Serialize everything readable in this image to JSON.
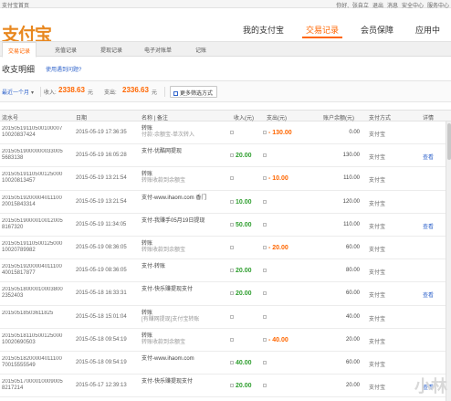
{
  "topbar": {
    "site": "支付宝首页",
    "links": [
      "你好,",
      "张自立",
      "退出",
      "消息",
      "安全中心",
      "服务中心"
    ]
  },
  "logo": "支付宝",
  "mainnav": [
    "我的支付宝",
    "交易记录",
    "会员保障",
    "应用中"
  ],
  "mainnav_active": 1,
  "subnav": [
    "交易记录",
    "充值记录",
    "提现记录",
    "电子对账单",
    "记账"
  ],
  "title": {
    "text": "收支明细",
    "link": "使用遇到问题?"
  },
  "filter": {
    "range": "最近一个月",
    "income_label": "收入:",
    "income_amount": "2338.63",
    "income_unit": "元",
    "expense_label": "支出:",
    "expense_amount": "2336.63",
    "expense_unit": "元",
    "more_btn": "更多筛选方式"
  },
  "table": {
    "headers": [
      "流水号",
      "日期",
      "名称 | 备注",
      "收入(元)",
      "支出(元)",
      "账户余额(元)",
      "支付方式",
      "详情"
    ],
    "rows": [
      {
        "sn1": "20150519110500100007",
        "sn2": "10020837424",
        "date": "2015-05-19 17:36:35",
        "name": "转账",
        "note": "付款-余额宝-单次转入",
        "income": "",
        "expense": "- 130.00",
        "balance": "0.00",
        "channel": "支付宝",
        "op": ""
      },
      {
        "sn1": "20150519000000033005",
        "sn2": "5683138",
        "date": "2015-05-19 16:05:28",
        "name": "支付-优酷网提现",
        "note": "",
        "income": "20.00",
        "expense": "",
        "balance": "130.00",
        "channel": "支付宝",
        "op": "查看"
      },
      {
        "sn1": "20150519110500125000",
        "sn2": "10020813457",
        "date": "2015-05-19 13:21:54",
        "name": "转账",
        "note": "转账收款到余额宝",
        "income": "",
        "expense": "- 10.00",
        "balance": "110.00",
        "channel": "支付宝",
        "op": ""
      },
      {
        "sn1": "20150519200004011100",
        "sn2": "20015843314",
        "date": "2015-05-19 13:21:54",
        "name": "支付-www.ihaom.com 香门",
        "note": "",
        "income": "10.00",
        "expense": "",
        "balance": "120.00",
        "channel": "支付宝",
        "op": ""
      },
      {
        "sn1": "20150519000010012005",
        "sn2": "8167320",
        "date": "2015-05-19 11:34:05",
        "name": "支付-我赚手05月19日提现",
        "note": "",
        "income": "50.00",
        "expense": "",
        "balance": "110.00",
        "channel": "支付宝",
        "op": "查看"
      },
      {
        "sn1": "20150519110500125000",
        "sn2": "10020789982",
        "date": "2015-05-19 08:36:05",
        "name": "转账",
        "note": "转账收款到余额宝",
        "income": "",
        "expense": "- 20.00",
        "balance": "60.00",
        "channel": "支付宝",
        "op": ""
      },
      {
        "sn1": "20150519200004011100",
        "sn2": "40015817877",
        "date": "2015-05-19 08:36:05",
        "name": "支付-转账",
        "note": "",
        "income": "20.00",
        "expense": "",
        "balance": "80.00",
        "channel": "支付宝",
        "op": ""
      },
      {
        "sn1": "20150518000010003800",
        "sn2": "2352403",
        "date": "2015-05-18 16:33:31",
        "name": "支付-快乐赚提现支付",
        "note": "",
        "income": "20.00",
        "expense": "",
        "balance": "60.00",
        "channel": "支付宝",
        "op": "查看"
      },
      {
        "sn1": "20150518503611825",
        "sn2": "",
        "date": "2015-05-18 15:01:04",
        "name": "转账",
        "note": "[有赚网提现]支付宝转账",
        "income": "",
        "expense": "",
        "balance": "40.00",
        "channel": "支付宝",
        "op": ""
      },
      {
        "sn1": "20150518110500125000",
        "sn2": "10020690503",
        "date": "2015-05-18 09:54:19",
        "name": "转账",
        "note": "转账收款到余额宝",
        "income": "",
        "expense": "- 40.00",
        "balance": "20.00",
        "channel": "支付宝",
        "op": ""
      },
      {
        "sn1": "20150518200004011100",
        "sn2": "70015555549",
        "date": "2015-05-18 09:54:19",
        "name": "支付-www.ihaom.com",
        "note": "",
        "income": "40.00",
        "expense": "",
        "balance": "60.00",
        "channel": "支付宝",
        "op": ""
      },
      {
        "sn1": "20150517000010009005",
        "sn2": "8217214",
        "date": "2015-05-17 12:39:13",
        "name": "支付-快乐赚提现支付",
        "note": "",
        "income": "20.00",
        "expense": "",
        "balance": "20.00",
        "channel": "支付宝",
        "op": "查看"
      }
    ]
  },
  "watermark": "小林"
}
